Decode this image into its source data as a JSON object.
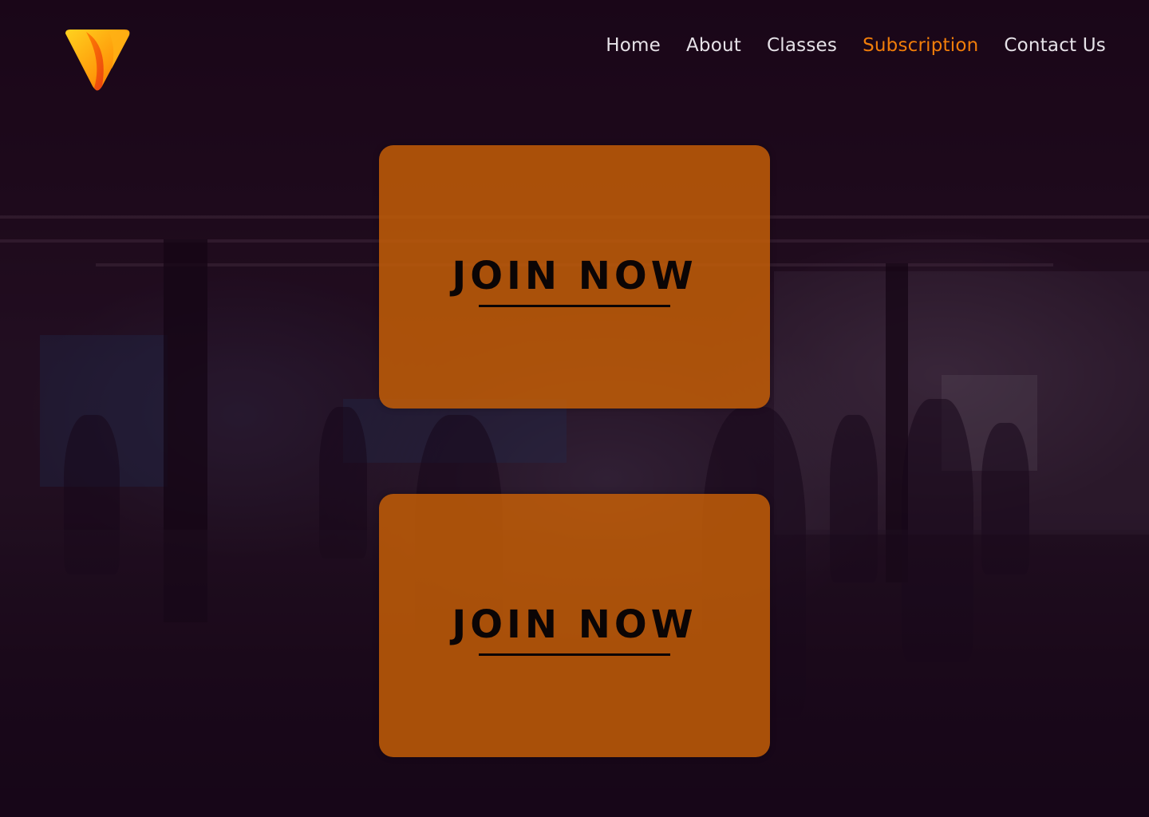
{
  "brand": {
    "logo_icon": "v-shield-logo-icon",
    "colors": {
      "accent": "#f07d0a",
      "card": "#c96006",
      "nav_text": "#e6e2e8",
      "background": "#1a0818"
    }
  },
  "nav": {
    "items": [
      {
        "label": "Home"
      },
      {
        "label": "About"
      },
      {
        "label": "Classes"
      },
      {
        "label": "Subscription"
      },
      {
        "label": "Contact Us"
      }
    ],
    "active": "Subscription"
  },
  "cards": [
    {
      "label": "JOIN NOW"
    },
    {
      "label": "JOIN NOW"
    }
  ]
}
